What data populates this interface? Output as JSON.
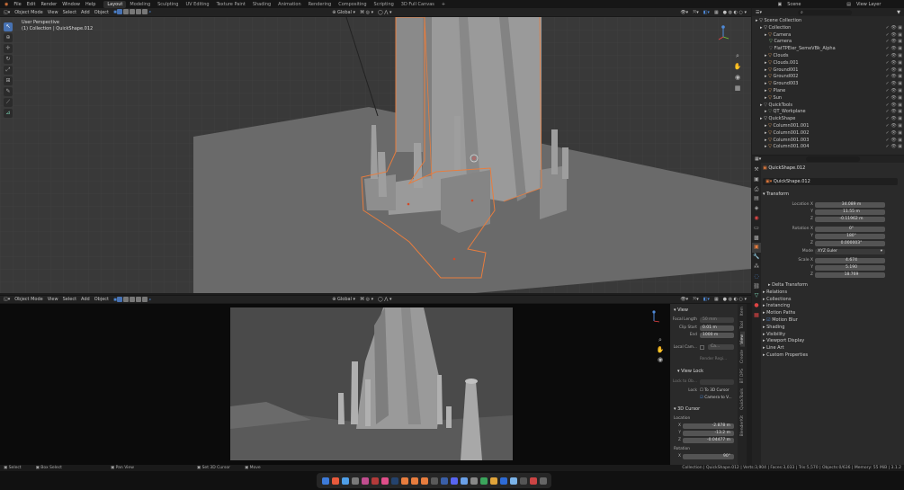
{
  "menubar": {
    "items": [
      "File",
      "Edit",
      "Render",
      "Window",
      "Help"
    ],
    "workspaces": [
      "Layout",
      "Modeling",
      "Sculpting",
      "UV Editing",
      "Texture Paint",
      "Shading",
      "Animation",
      "Rendering",
      "Compositing",
      "Scripting",
      "3D Full Canvas"
    ],
    "active_workspace": "Layout",
    "scene": "Scene",
    "view_layer": "View Layer"
  },
  "viewport_top": {
    "mode": "Object Mode",
    "menus": [
      "View",
      "Select",
      "Add",
      "Object"
    ],
    "orientation": "Global",
    "info_line1": "User Perspective",
    "info_line2": "(1) Collection | QuickShape.012"
  },
  "viewport_bottom": {
    "mode": "Object Mode",
    "menus": [
      "View",
      "Select",
      "Add",
      "Object"
    ],
    "orientation": "Global"
  },
  "npanel": {
    "view_header": "View",
    "focal_length_label": "Focal Length",
    "focal_length": "50 mm",
    "clip_start_label": "Clip Start",
    "clip_start": "0.01 m",
    "clip_end_label": "End",
    "clip_end": "1000 m",
    "local_camera_label": "Local Cam...",
    "local_camera_value": "Ca...",
    "render_region": "Render Regi...",
    "view_lock_header": "View Lock",
    "lock_to_object_label": "Lock to Ob...",
    "lock_label": "Lock",
    "to_3d_cursor": "To 3D Cursor",
    "camera_to_view": "Camera to V...",
    "cursor_header": "3D Cursor",
    "location_label": "Location",
    "x_label": "X",
    "x": "-2.878 m",
    "y_label": "Y",
    "y": "-13.2 m",
    "z_label": "Z",
    "z": "-0.04477 m",
    "rotation_label": "Rotation",
    "rx": "90°",
    "tabs": [
      "Item",
      "Tool",
      "View",
      "Create",
      "BT DPS",
      "QuickTools",
      "BlenderKit"
    ]
  },
  "outliner": {
    "search_placeholder": "",
    "rows": [
      {
        "name": "Scene Collection",
        "indent": 0,
        "color": "#cccccc"
      },
      {
        "name": "Collection",
        "indent": 1,
        "color": "#cccccc"
      },
      {
        "name": "Camera",
        "indent": 2,
        "color": "#e29d5b"
      },
      {
        "name": "Camera",
        "indent": 3,
        "color": "#86c48a"
      },
      {
        "name": "FlatTPEier_SemeVBk_Alpha",
        "indent": 3,
        "color": "#7c7c7c"
      },
      {
        "name": "Clouds",
        "indent": 2,
        "color": "#e29d5b"
      },
      {
        "name": "Clouds.001",
        "indent": 2,
        "color": "#e29d5b"
      },
      {
        "name": "Ground001",
        "indent": 2,
        "color": "#e29d5b"
      },
      {
        "name": "Ground002",
        "indent": 2,
        "color": "#e29d5b"
      },
      {
        "name": "Ground003",
        "indent": 2,
        "color": "#e29d5b"
      },
      {
        "name": "Plane",
        "indent": 2,
        "color": "#e29d5b"
      },
      {
        "name": "Sun",
        "indent": 2,
        "color": "#e29d5b"
      },
      {
        "name": "QuickTools",
        "indent": 1,
        "color": "#8d8d8d"
      },
      {
        "name": "QT_Workplane",
        "indent": 2,
        "color": "#6a7f6a"
      },
      {
        "name": "QuickShape",
        "indent": 1,
        "color": "#cccccc"
      },
      {
        "name": "Column001.001",
        "indent": 2,
        "color": "#e29d5b"
      },
      {
        "name": "Column001.002",
        "indent": 2,
        "color": "#e29d5b"
      },
      {
        "name": "Column001.003",
        "indent": 2,
        "color": "#e29d5b"
      },
      {
        "name": "Column001.004",
        "indent": 2,
        "color": "#e29d5b"
      }
    ]
  },
  "properties": {
    "object_name": "QuickShape.012",
    "object_name_field": "QuickShape.012",
    "transform_header": "Transform",
    "location_x_label": "Location X",
    "location_x": "34.089 m",
    "location_y_label": "Y",
    "location_y": "11.55 m",
    "location_z_label": "Z",
    "location_z": "-0.11962 m",
    "rotation_x_label": "Rotation X",
    "rotation_x": "0°",
    "rotation_y_label": "Y",
    "rotation_y": "180°",
    "rotation_z_label": "Z",
    "rotation_z": "0.000003°",
    "mode_label": "Mode",
    "mode": "XYZ Euler",
    "scale_x_label": "Scale X",
    "scale_x": "4.674",
    "scale_y_label": "Y",
    "scale_y": "5.190",
    "scale_z_label": "Z",
    "scale_z": "18.769",
    "panels": [
      "Delta Transform",
      "Relations",
      "Collections",
      "Instancing",
      "Motion Paths",
      "Motion Blur",
      "Shading",
      "Visibility",
      "Viewport Display",
      "Line Art",
      "Custom Properties"
    ]
  },
  "statusbar": {
    "left": [
      "Select",
      "Box Select",
      "Pan View",
      "Set 3D Cursor",
      "Move"
    ],
    "right": "Collection | QuickShape.012 | Verts:3,904 | Faces:3,033 | Tris:5,570 | Objects:0/636 | Memory: 55 MiB | 3.1.2"
  },
  "colors": {
    "accent": "#4772b3",
    "selection": "#e87d3e"
  }
}
